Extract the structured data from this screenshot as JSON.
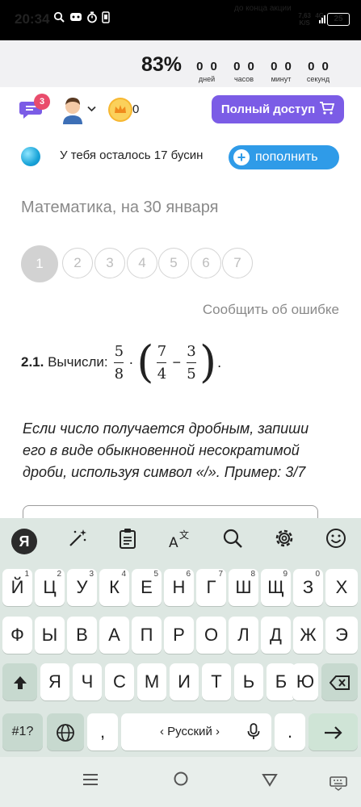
{
  "status_bar": {
    "time": "20:34",
    "net_speed_value": "7,63",
    "net_speed_unit": "K/S",
    "net_type": "4G",
    "battery": "25"
  },
  "promo": {
    "caption": "до конца акции",
    "percent": "83%",
    "countdown": [
      {
        "value": "00",
        "label": "дней"
      },
      {
        "value": "00",
        "label": "часов"
      },
      {
        "value": "00",
        "label": "минут"
      },
      {
        "value": "00",
        "label": "секунд"
      }
    ]
  },
  "header": {
    "chat_badge": "3",
    "coins": "0",
    "full_access_label": "Полный доступ"
  },
  "beads": {
    "text": "У тебя осталось 17 бусин",
    "topup_label": "пополнить"
  },
  "content": {
    "section_title": "Математика, на 30 января",
    "question_numbers": [
      "1",
      "2",
      "3",
      "4",
      "5",
      "6",
      "7"
    ],
    "active_question": "1",
    "report_error": "Сообщить об ошибке",
    "task_number": "2.1.",
    "task_text": "Вычисли:",
    "expression": {
      "f1_num": "5",
      "f1_den": "8",
      "op1": "·",
      "f2_num": "7",
      "f2_den": "4",
      "op2": "−",
      "f3_num": "3",
      "f3_den": "5",
      "end": "."
    },
    "instruction": "Если число получается дробным, запиши его в виде обыкновенной несократимой дроби, используя символ «/». Пример: 3/7"
  },
  "keyboard": {
    "yandex_label": "Я",
    "row1": [
      "Й",
      "Ц",
      "У",
      "К",
      "Е",
      "Н",
      "Г",
      "Ш",
      "Щ",
      "З",
      "Х"
    ],
    "row1_hints": [
      "1",
      "2",
      "3",
      "4",
      "5",
      "6",
      "7",
      "8",
      "9",
      "0",
      ""
    ],
    "row2": [
      "Ф",
      "Ы",
      "В",
      "А",
      "П",
      "Р",
      "О",
      "Л",
      "Д",
      "Ж",
      "Э"
    ],
    "row3": [
      "Я",
      "Ч",
      "С",
      "М",
      "И",
      "Т",
      "Ь",
      "Б",
      "Ю"
    ],
    "symbols_label": "#1?",
    "comma": ",",
    "space_label": "‹ Русский ›",
    "period": "."
  },
  "colors": {
    "accent_purple": "#7b5ce6",
    "topup_blue": "#2f9be8",
    "badge_red": "#e94c6c",
    "keyboard_bg": "#dde7e2"
  }
}
